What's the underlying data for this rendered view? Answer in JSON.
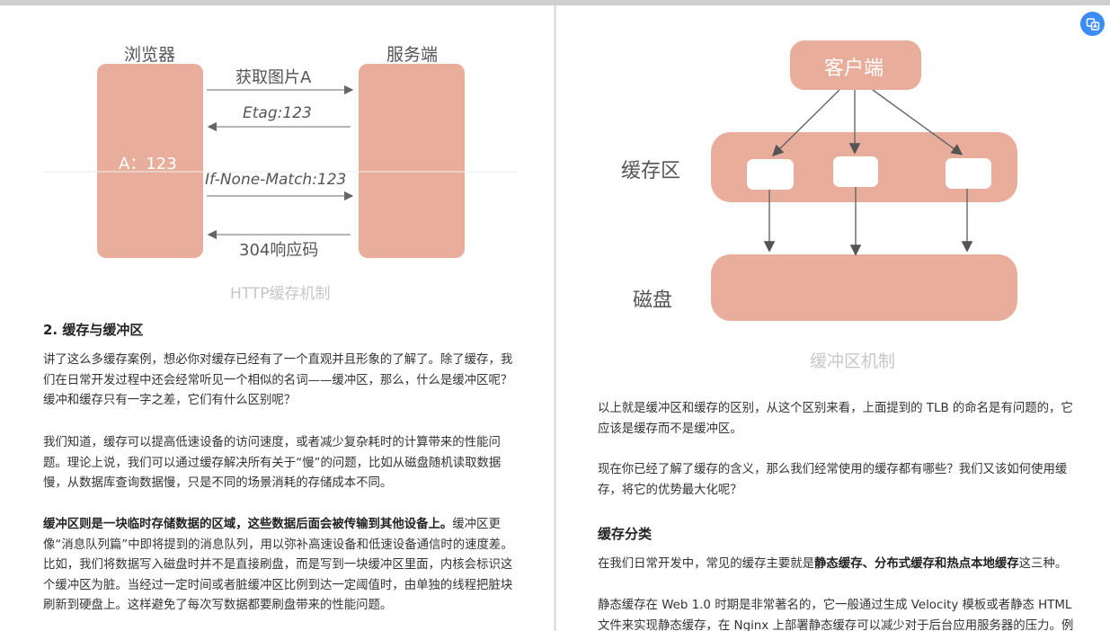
{
  "left": {
    "diagram": {
      "browser_label": "浏览器",
      "server_label": "服务端",
      "cache_value": "A：123",
      "arrows": [
        "获取图片A",
        "Etag:123",
        "If-None-Match:123",
        "304响应码"
      ],
      "caption": "HTTP缓存机制"
    },
    "heading": "2. 缓存与缓冲区",
    "p1": "讲了这么多缓存案例，想必你对缓存已经有了一个直观并且形象的了解了。除了缓存，我们在日常开发过程中还会经常听见一个相似的名词——缓冲区，那么，什么是缓冲区呢？缓冲和缓存只有一字之差，它们有什么区别呢？",
    "p2": "我们知道，缓存可以提高低速设备的访问速度，或者减少复杂耗时的计算带来的性能问题。理论上说，我们可以通过缓存解决所有关于“慢”的问题，比如从磁盘随机读取数据慢，从数据库查询数据慢，只是不同的场景消耗的存储成本不同。",
    "p3_bold": "缓冲区则是一块临时存储数据的区域，这些数据后面会被传输到其他设备上。",
    "p3_rest": "缓冲区更像“消息队列篇”中即将提到的消息队列，用以弥补高速设备和低速设备通信时的速度差。比如，我们将数据写入磁盘时并不是直接刷盘，而是写到一块缓冲区里面，内核会标识这个缓冲区为脏。当经过一定时间或者脏缓冲区比例到达一定阈值时，由单独的线程把脏块刷新到硬盘上。这样避免了每次写数据都要刷盘带来的性能问题。"
  },
  "right": {
    "diagram": {
      "client_label": "客户端",
      "buffer_label": "缓存区",
      "disk_label": "磁盘",
      "caption": "缓冲区机制"
    },
    "p1": "以上就是缓冲区和缓存的区别，从这个区别来看，上面提到的 TLB 的命名是有问题的，它应该是缓存而不是缓冲区。",
    "p2": "现在你已经了解了缓存的含义，那么我们经常使用的缓存都有哪些？我们又该如何使用缓存，将它的优势最大化呢？",
    "heading": "缓存分类",
    "p3_pre": "在我们日常开发中，常见的缓存主要就是",
    "p3_bold": "静态缓存、分布式缓存和热点本地缓存",
    "p3_post": "这三种。",
    "p4": "静态缓存在 Web 1.0 时期是非常著名的，它一般通过生成 Velocity 模板或者静态 HTML 文件来实现静态缓存，在 Nginx 上部署静态缓存可以减少对于后台应用服务器的压力。例"
  },
  "colors": {
    "box": "#e8ad9b",
    "caption": "#c7c7c7",
    "accent_button": "#3b8cf5"
  },
  "floating_button_icon": "translate-icon"
}
